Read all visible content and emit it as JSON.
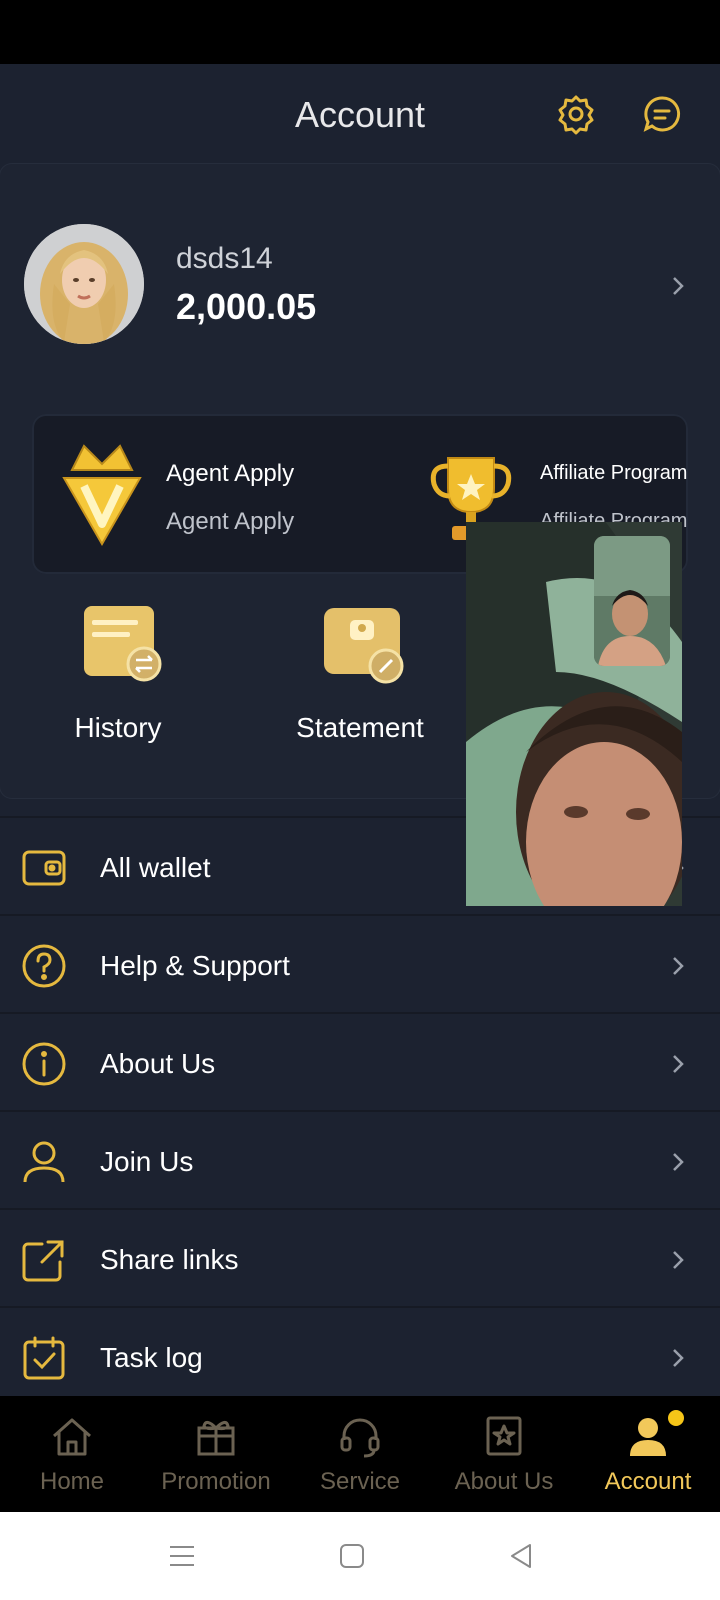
{
  "header": {
    "title": "Account",
    "settings_icon": "gear-icon",
    "message_icon": "chat-bubble-icon"
  },
  "profile": {
    "username": "dsds14",
    "balance": "2,000.05"
  },
  "promos": [
    {
      "title": "Agent Apply",
      "subtitle": "Agent Apply",
      "icon": "crown-diamond-icon"
    },
    {
      "title": "Affiliate Program",
      "subtitle": "Affiliate Program",
      "icon": "trophy-icon"
    }
  ],
  "quick_actions": [
    {
      "label": "History",
      "icon": "history-document-icon"
    },
    {
      "label": "Statement",
      "icon": "statement-wallet-icon"
    }
  ],
  "menu": [
    {
      "label": "All wallet",
      "icon": "wallet-icon"
    },
    {
      "label": "Help & Support",
      "icon": "question-circle-icon"
    },
    {
      "label": "About Us",
      "icon": "info-circle-icon"
    },
    {
      "label": "Join Us",
      "icon": "user-icon"
    },
    {
      "label": "Share links",
      "icon": "share-icon"
    },
    {
      "label": "Task log",
      "icon": "task-check-icon"
    }
  ],
  "bottom_nav": [
    {
      "label": "Home",
      "icon": "home-icon"
    },
    {
      "label": "Promotion",
      "icon": "gift-icon"
    },
    {
      "label": "Service",
      "icon": "headset-icon"
    },
    {
      "label": "About Us",
      "icon": "bookmark-star-icon"
    },
    {
      "label": "Account",
      "icon": "person-icon",
      "active": true,
      "badge": true
    }
  ],
  "colors": {
    "accent_gold": "#f2c85a",
    "background": "#1c2230",
    "nav_inactive": "#6b6252"
  }
}
